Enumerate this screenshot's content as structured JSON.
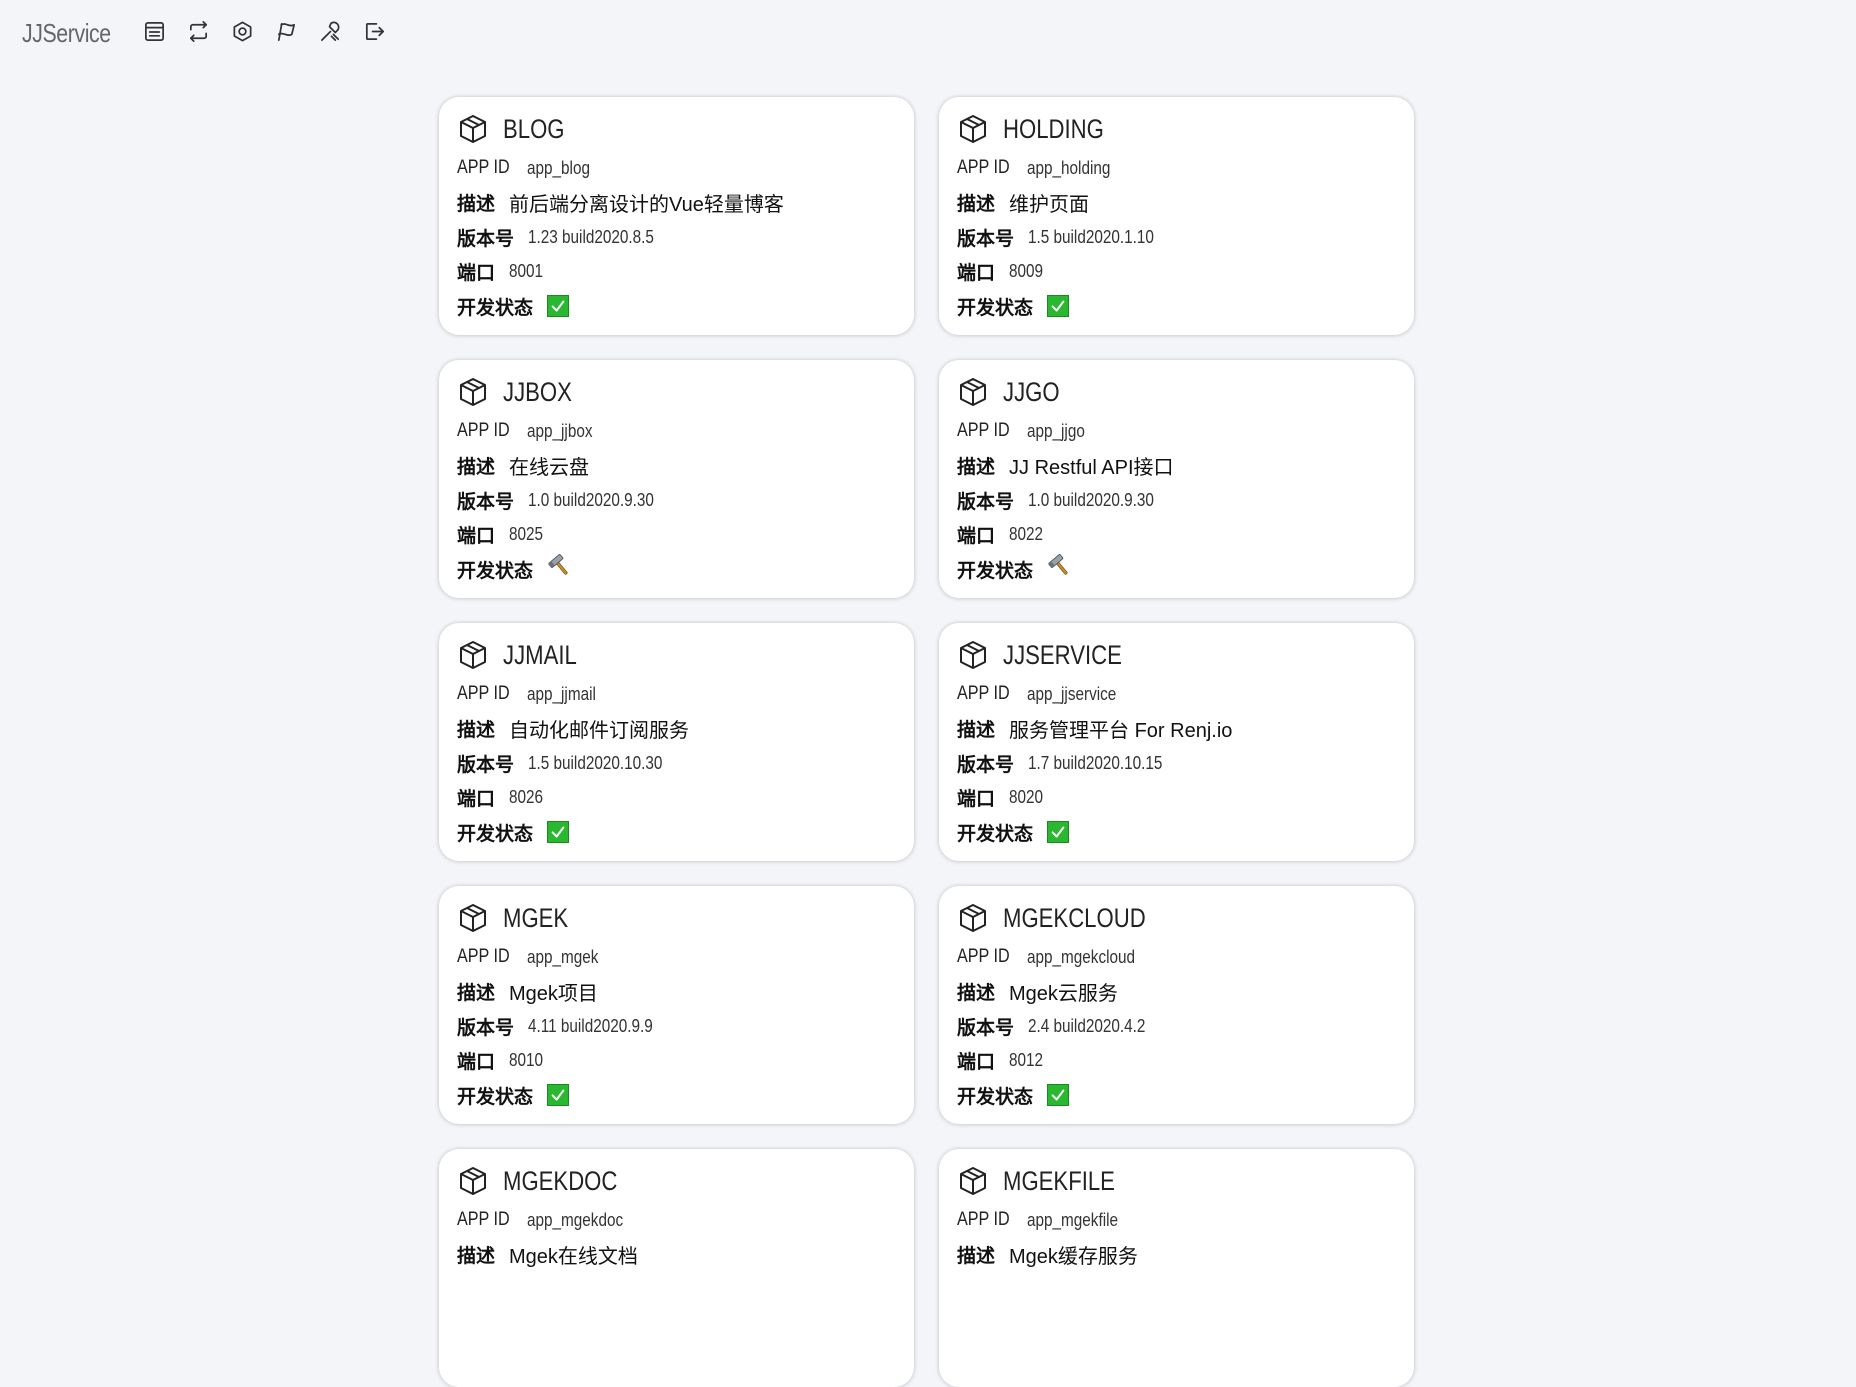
{
  "app": {
    "brand": "JJService"
  },
  "nav": [
    {
      "icon": "list-icon"
    },
    {
      "icon": "sync-icon"
    },
    {
      "icon": "settings-icon"
    },
    {
      "icon": "flag-icon"
    },
    {
      "icon": "tools-icon"
    },
    {
      "icon": "logout-icon"
    }
  ],
  "labels": {
    "app_id": "APP ID",
    "desc": "描述",
    "version": "版本号",
    "port": "端口",
    "status": "开发状态"
  },
  "colors": {
    "status_ok": "#29b82f",
    "background": "#f4f5f9"
  },
  "services": [
    {
      "name": "BLOG",
      "app_id": "app_blog",
      "desc": "前后端分离设计的Vue轻量博客",
      "version": "1.23 build2020.8.5",
      "port": "8001",
      "status": "done"
    },
    {
      "name": "HOLDING",
      "app_id": "app_holding",
      "desc": "维护页面",
      "version": "1.5 build2020.1.10",
      "port": "8009",
      "status": "done"
    },
    {
      "name": "JJBOX",
      "app_id": "app_jjbox",
      "desc": "在线云盘",
      "version": "1.0 build2020.9.30",
      "port": "8025",
      "status": "developing"
    },
    {
      "name": "JJGO",
      "app_id": "app_jjgo",
      "desc": "JJ Restful API接口",
      "version": "1.0 build2020.9.30",
      "port": "8022",
      "status": "developing"
    },
    {
      "name": "JJMAIL",
      "app_id": "app_jjmail",
      "desc": "自动化邮件订阅服务",
      "version": "1.5 build2020.10.30",
      "port": "8026",
      "status": "done"
    },
    {
      "name": "JJSERVICE",
      "app_id": "app_jjservice",
      "desc": "服务管理平台 For Renj.io",
      "version": "1.7 build2020.10.15",
      "port": "8020",
      "status": "done"
    },
    {
      "name": "MGEK",
      "app_id": "app_mgek",
      "desc": "Mgek项目",
      "version": "4.11 build2020.9.9",
      "port": "8010",
      "status": "done"
    },
    {
      "name": "MGEKCLOUD",
      "app_id": "app_mgekcloud",
      "desc": "Mgek云服务",
      "version": "2.4 build2020.4.2",
      "port": "8012",
      "status": "done"
    },
    {
      "name": "MGEKDOC",
      "app_id": "app_mgekdoc",
      "desc": "Mgek在线文档"
    },
    {
      "name": "MGEKFILE",
      "app_id": "app_mgekfile",
      "desc": "Mgek缓存服务"
    }
  ]
}
